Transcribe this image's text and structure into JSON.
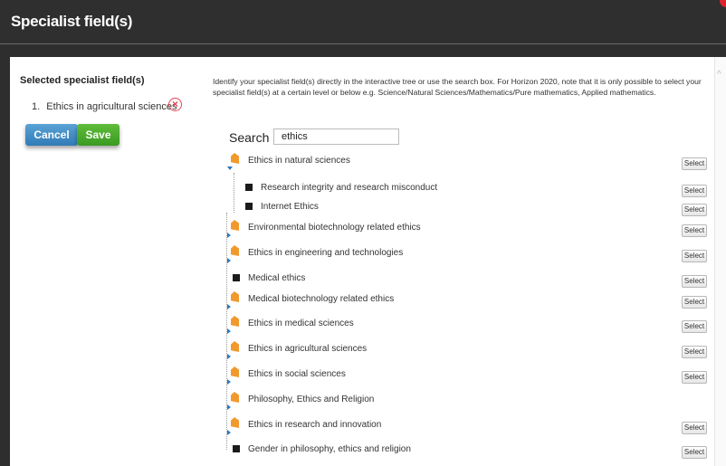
{
  "header": {
    "title": "Specialist field(s)"
  },
  "left": {
    "title": "Selected specialist field(s)",
    "selected_items": [
      {
        "number": "1.",
        "label": "Ethics in agricultural sciences"
      }
    ],
    "remove_glyph": "×",
    "cancel_label": "Cancel",
    "save_label": "Save"
  },
  "right": {
    "description": "Identify your specialist field(s) directly in the interactive tree or use the search box. For Horizon 2020, note that it is only possible to select your specialist field(s) at a certain level or below e.g. Science/Natural Sciences/Mathematics/Pure mathematics, Applied mathematics.",
    "search_label": "Search",
    "search_value": "ethics",
    "select_label": "Select",
    "tree": [
      {
        "label": "Ethics in natural sciences",
        "icon": "folder-icon",
        "expander": "expanded",
        "select": true
      },
      {
        "label": "Research integrity and research misconduct",
        "icon": "checkbox-icon",
        "indent": 1,
        "select": true
      },
      {
        "label": "Internet Ethics",
        "icon": "checkbox-icon",
        "indent": 1,
        "select": true
      },
      {
        "label": "Environmental biotechnology related ethics",
        "icon": "folder-icon",
        "expander": "collapsed",
        "select": true
      },
      {
        "label": "Ethics in engineering and technologies",
        "icon": "folder-icon",
        "expander": "collapsed",
        "select": true
      },
      {
        "label": "Medical ethics",
        "icon": "checkbox-icon",
        "select": true
      },
      {
        "label": "Medical biotechnology related ethics",
        "icon": "folder-icon",
        "expander": "collapsed",
        "select": true
      },
      {
        "label": "Ethics in medical sciences",
        "icon": "folder-icon",
        "expander": "collapsed",
        "select": true
      },
      {
        "label": "Ethics in agricultural sciences",
        "icon": "folder-icon",
        "expander": "collapsed",
        "select": true
      },
      {
        "label": "Ethics in social sciences",
        "icon": "folder-icon",
        "expander": "collapsed",
        "select": true
      },
      {
        "label": "Philosophy, Ethics and Religion",
        "icon": "folder-icon",
        "expander": "collapsed",
        "select": false
      },
      {
        "label": "Ethics in research and innovation",
        "icon": "folder-icon",
        "expander": "collapsed",
        "select": true
      },
      {
        "label": "Gender in philosophy, ethics and religion",
        "icon": "checkbox-icon",
        "select": true
      }
    ]
  },
  "colors": {
    "header_bg": "#2f2f2f",
    "cancel_blue": "#3d8cc8",
    "save_green": "#4aa82c",
    "folder_orange": "#f2992e",
    "remove_red": "#e0474f"
  }
}
